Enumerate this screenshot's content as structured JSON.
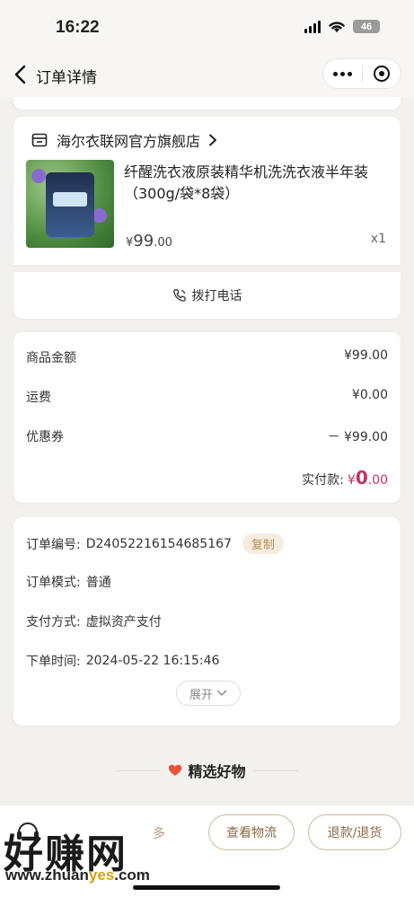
{
  "status_bar": {
    "time": "16:22",
    "battery": "46"
  },
  "nav": {
    "title": "订单详情"
  },
  "store": {
    "name": "海尔衣联网官方旗舰店",
    "product_title": "纤醒洗衣液原装精华机洗洗衣液半年装（300g/袋*8袋）",
    "price_symbol": "¥",
    "price_int": "99",
    "price_dec": ".00",
    "quantity": "x1"
  },
  "call": {
    "label": "拨打电话"
  },
  "amounts": {
    "goods_label": "商品金额",
    "goods_value": "¥99.00",
    "shipping_label": "运费",
    "shipping_value": "¥0.00",
    "coupon_label": "优惠券",
    "coupon_value": "－ ¥99.00",
    "paid_label": "实付款:",
    "paid_symbol": "¥",
    "paid_int": "0",
    "paid_dec": ".00"
  },
  "order_info": {
    "number_label": "订单编号:",
    "number_value": "D24052216154685167",
    "copy_label": "复制",
    "mode_label": "订单模式:",
    "mode_value": "普通",
    "pay_label": "支付方式:",
    "pay_value": "虚拟资产支付",
    "time_label": "下单时间:",
    "time_value": "2024-05-22 16:15:46",
    "expand_label": "展开"
  },
  "recommend": {
    "title": "精选好物"
  },
  "bottom_bar": {
    "more_label": "多",
    "logistics_label": "查看物流",
    "refund_label": "退款/退货"
  },
  "watermark": {
    "text": "好赚网",
    "url_a": "www.zhuan",
    "url_b": "yes",
    "url_c": ".com"
  },
  "colors": {
    "accent_red": "#c83060",
    "gold": "#8a6a45"
  }
}
